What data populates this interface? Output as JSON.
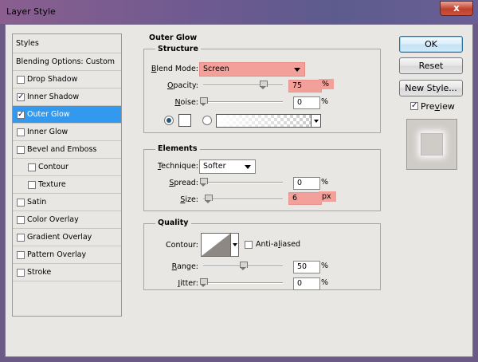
{
  "window": {
    "title": "Layer Style",
    "close_label": "x"
  },
  "styles_list": {
    "header": "Styles",
    "blending_options": "Blending Options: Custom",
    "items": [
      {
        "label": "Drop Shadow",
        "checked": false,
        "sub": false,
        "selected": false
      },
      {
        "label": "Inner Shadow",
        "checked": true,
        "sub": false,
        "selected": false
      },
      {
        "label": "Outer Glow",
        "checked": true,
        "sub": false,
        "selected": true
      },
      {
        "label": "Inner Glow",
        "checked": false,
        "sub": false,
        "selected": false
      },
      {
        "label": "Bevel and Emboss",
        "checked": false,
        "sub": false,
        "selected": false
      },
      {
        "label": "Contour",
        "checked": false,
        "sub": true,
        "selected": false
      },
      {
        "label": "Texture",
        "checked": false,
        "sub": true,
        "selected": false
      },
      {
        "label": "Satin",
        "checked": false,
        "sub": false,
        "selected": false
      },
      {
        "label": "Color Overlay",
        "checked": false,
        "sub": false,
        "selected": false
      },
      {
        "label": "Gradient Overlay",
        "checked": false,
        "sub": false,
        "selected": false
      },
      {
        "label": "Pattern Overlay",
        "checked": false,
        "sub": false,
        "selected": false
      },
      {
        "label": "Stroke",
        "checked": false,
        "sub": false,
        "selected": false
      }
    ]
  },
  "outer_glow": {
    "title": "Outer Glow",
    "structure": {
      "label": "Structure",
      "blend_mode_label_u": "B",
      "blend_mode_label_rest": "lend Mode:",
      "blend_mode_value": "Screen",
      "opacity_label_u": "O",
      "opacity_label_rest": "pacity:",
      "opacity_value": "75",
      "opacity_unit": "%",
      "opacity_level": 0.75,
      "noise_label_u": "N",
      "noise_label_rest": "oise:",
      "noise_value": "0",
      "noise_unit": "%",
      "noise_level": 0,
      "color_mode": "solid"
    },
    "elements": {
      "label": "Elements",
      "technique_label_u": "T",
      "technique_label_rest": "echnique:",
      "technique_value": "Softer",
      "spread_label_u": "S",
      "spread_label_rest": "pread:",
      "spread_value": "0",
      "spread_unit": "%",
      "spread_level": 0,
      "size_label_u": "S",
      "size_label_rest": "ize:",
      "size_value": "6",
      "size_unit": "px",
      "size_level": 0.06
    },
    "quality": {
      "label": "Quality",
      "contour_label": "Contour:",
      "anti_aliased_label_u": "l",
      "anti_aliased_label_pre": "Anti-a",
      "anti_aliased_label_rest": "iased",
      "anti_aliased_checked": false,
      "range_label_u": "R",
      "range_label_rest": "ange:",
      "range_value": "50",
      "range_unit": "%",
      "range_level": 0.5,
      "jitter_label_u": "J",
      "jitter_label_rest": "itter:",
      "jitter_value": "0",
      "jitter_unit": "%",
      "jitter_level": 0
    }
  },
  "buttons": {
    "ok": "OK",
    "reset": "Reset",
    "new_style": "New Style...",
    "preview_label_u": "v",
    "preview_label_pre": "Pre",
    "preview_label_rest": "iew",
    "preview_checked": true
  },
  "colors": {
    "highlight": "#f4a09a",
    "selected": "#3399ee"
  }
}
